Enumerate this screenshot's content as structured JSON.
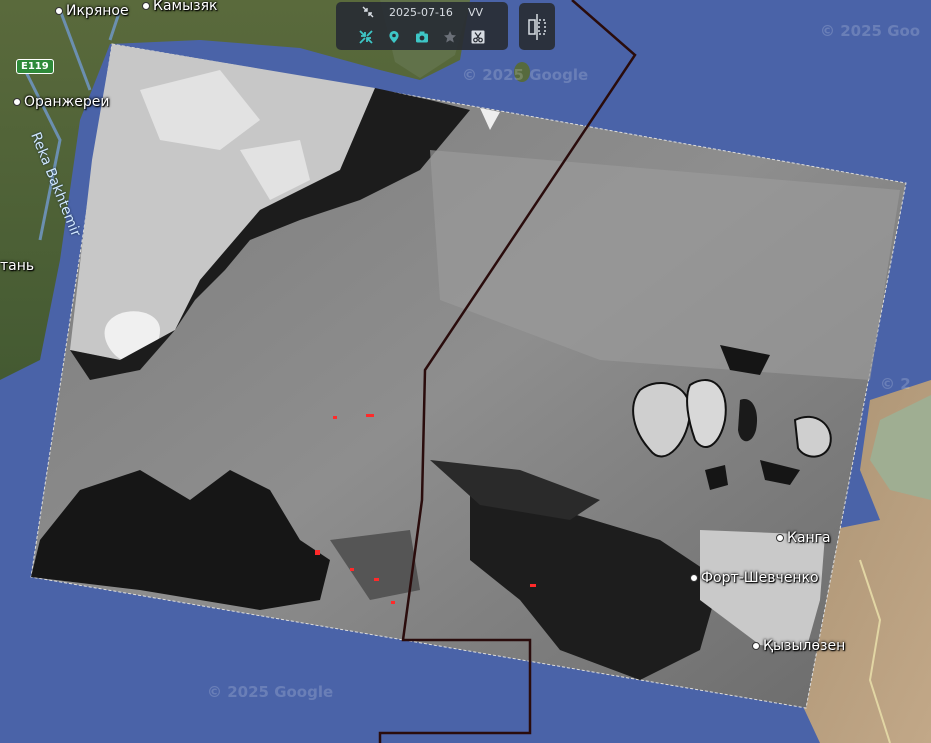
{
  "toolbar": {
    "date": "2025-07-16",
    "polarization": "VV",
    "top_icon": "collapse-arrows-icon",
    "buttons": [
      {
        "icon": "collapse-arrows-icon"
      },
      {
        "icon": "map-pin-icon"
      },
      {
        "icon": "camera-icon"
      },
      {
        "icon": "star-icon"
      },
      {
        "icon": "scissors-icon"
      }
    ],
    "accent_color": "#3ec6c6"
  },
  "compare_button": {
    "icon": "split-compare-icon"
  },
  "places": {
    "ikryanoe": "Икряное",
    "kamyzyak": "Камызяк",
    "oranzherei": "Оранжереи",
    "partial_left": "тань",
    "kanga": "Канга",
    "fort_shevchenko": "Форт-Шевченко",
    "kyzylozen": "Қызылөзен"
  },
  "river_label": "Reka Bakhtemir",
  "road_badge": "E119",
  "watermarks": [
    "© 2025 Google",
    "© 2025 Google",
    "© 2025 Google",
    "© 2025 Goo",
    "© 2"
  ],
  "colors": {
    "sea": "#4a63a8",
    "boundary_line": "#2a0c0c",
    "oil_spill_marks": "#ff2a2a"
  }
}
